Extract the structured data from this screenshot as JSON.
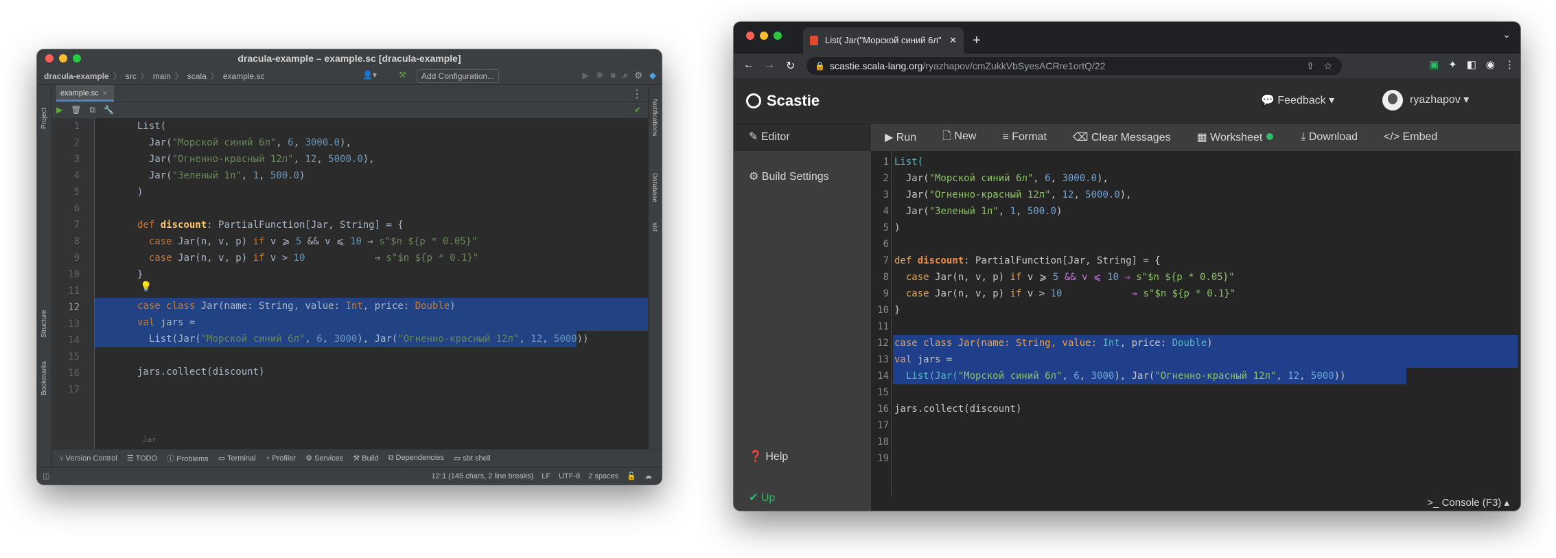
{
  "ide": {
    "title": "dracula-example – example.sc [dracula-example]",
    "breadcrumbs": [
      "dracula-example",
      "src",
      "main",
      "scala",
      "example.sc"
    ],
    "run_config": "Add Configuration...",
    "tab": "example.sc",
    "left_tools": [
      "Project",
      "Structure",
      "Bookmarks"
    ],
    "right_tools": [
      "Notifications",
      "Database",
      "sbt"
    ],
    "hint": "Jar",
    "bottom_tools": [
      "Version Control",
      "TODO",
      "Problems",
      "Terminal",
      "Profiler",
      "Services",
      "Build",
      "Dependencies",
      "sbt shell"
    ],
    "status": [
      "12:1 (145 chars, 2 line breaks)",
      "LF",
      "UTF-8",
      "2 spaces"
    ],
    "line_numbers": [
      "1",
      "2",
      "3",
      "4",
      "5",
      "6",
      "7",
      "8",
      "9",
      "10",
      "11",
      "12",
      "13",
      "14",
      "15",
      "16",
      "17"
    ],
    "code": {
      "l1": "List(",
      "l2a": "  Jar(",
      "l2b": "\"Морской синий 6л\"",
      "l2c": ", ",
      "l2d": "6",
      "l2e": ", ",
      "l2f": "3000.0",
      "l2g": "),",
      "l3a": "  Jar(",
      "l3b": "\"Огненно-красный 12л\"",
      "l3c": ", ",
      "l3d": "12",
      "l3e": ", ",
      "l3f": "5000.0",
      "l3g": "),",
      "l4a": "  Jar(",
      "l4b": "\"Зеленый 1л\"",
      "l4c": ", ",
      "l4d": "1",
      "l4e": ", ",
      "l4f": "500.0",
      "l4g": ")",
      "l5": ")",
      "l7a": "def ",
      "l7b": "discount",
      "l7c": ": PartialFunction[Jar, String] = {",
      "l8a": "  case ",
      "l8b": "Jar(n, v, p) ",
      "l8c": "if ",
      "l8d": "v ⩾ ",
      "l8e": "5",
      "l8f": " && v ⩽ ",
      "l8g": "10",
      "l8h": " ⇒ ",
      "l8i": "s\"$n ${p * 0.05}\"",
      "l9a": "  case ",
      "l9b": "Jar(n, v, p) ",
      "l9c": "if ",
      "l9d": "v > ",
      "l9e": "10",
      "l9f": "            ⇒ ",
      "l9g": "s\"$n ${p * 0.1}\"",
      "l10": "}",
      "l12a": "case class ",
      "l12b": "Jar(name: String, value: ",
      "l12c": "Int",
      "l12d": ", price: ",
      "l12e": "Double",
      "l12f": ")",
      "l13a": "val ",
      "l13b": "jars =",
      "l14a": "  List(Jar(",
      "l14b": "\"Морской синий 6л\"",
      "l14c": ", ",
      "l14d": "6",
      "l14e": ", ",
      "l14f": "3000",
      "l14g": "), Jar(",
      "l14h": "\"Огненно-красный 12л\"",
      "l14i": ", ",
      "l14j": "12",
      "l14k": ", ",
      "l14l": "5000",
      "l14m": "))",
      "l16": "jars.collect(discount)"
    }
  },
  "browser": {
    "tab_title": "List( Jar(\"Морской синий 6л\"",
    "url_host": "scastie.scala-lang.org",
    "url_path": "/ryazhapov/cmZukkVbSyesACRre1ortQ/22",
    "brand": "Scastie",
    "feedback": "Feedback",
    "user": "ryazhapov",
    "sidebar": [
      "Editor",
      "Build Settings",
      "Help",
      "Up"
    ],
    "toolbar": [
      "Run",
      "New",
      "Format",
      "Clear Messages",
      "Worksheet",
      "Download",
      "Embed"
    ],
    "console": "Console (F3)",
    "line_numbers": [
      "1",
      "2",
      "3",
      "4",
      "5",
      "6",
      "7",
      "8",
      "9",
      "10",
      "11",
      "12",
      "13",
      "14",
      "15",
      "16",
      "17",
      "18",
      "19"
    ]
  },
  "colors": {
    "ide_bg": "#2b2b2b",
    "selection": "#214283",
    "scastie_green": "#2ebb6b"
  }
}
